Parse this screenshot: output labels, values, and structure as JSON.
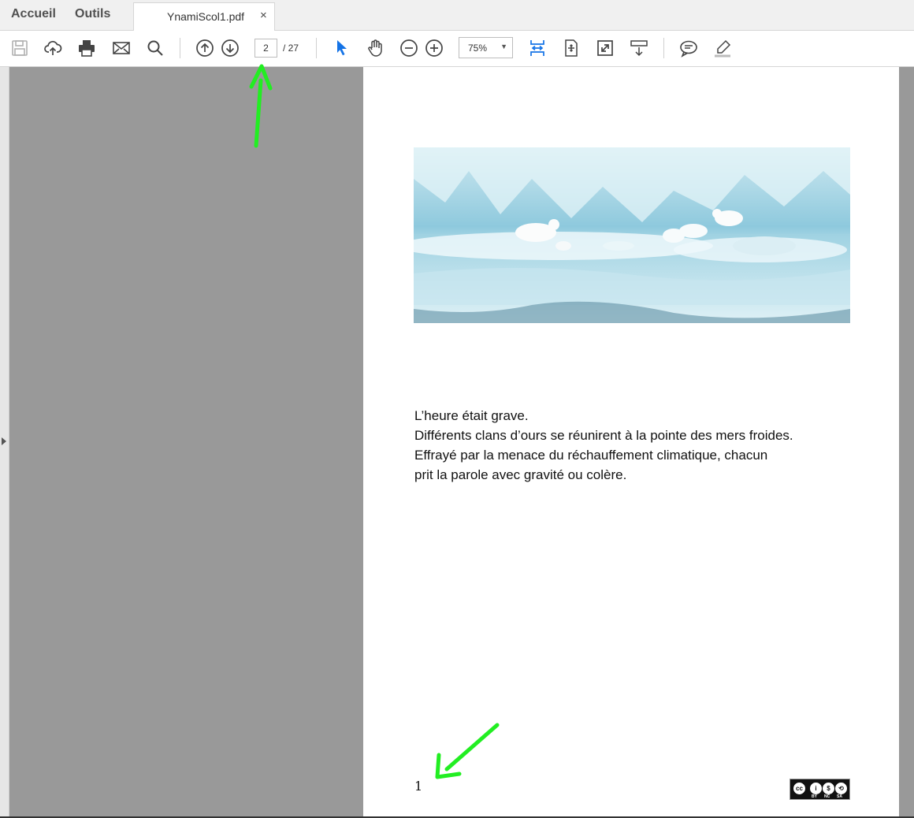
{
  "nav": {
    "home_label": "Accueil",
    "tools_label": "Outils"
  },
  "tab": {
    "filename": "YnamiScol1.pdf",
    "close_glyph": "×"
  },
  "toolbar": {
    "icons": [
      "save-icon",
      "upload-icon",
      "print-icon",
      "email-icon",
      "search-icon",
      "page-up-icon",
      "page-down-icon",
      "select-cursor-icon",
      "hand-icon",
      "zoom-out-icon",
      "zoom-in-icon",
      "fit-width-icon",
      "fit-page-icon",
      "fullscreen-icon",
      "scroll-mode-icon",
      "comment-icon",
      "highlight-icon"
    ],
    "current_page": "2",
    "page_total": "/ 27",
    "zoom": "75%",
    "accent_color": "#1473e6"
  },
  "document": {
    "lines": [
      "L’heure était grave.",
      "Différents clans d’ours se réunirent à la pointe des mers froides.",
      "Effrayé par la menace du réchauffement climatique,  chacun",
      "prit la parole avec gravité ou colère."
    ],
    "page_number": "1",
    "license": {
      "by": "BY",
      "nc": "NC",
      "sa": "SA"
    }
  },
  "annotations": {
    "arrow_color": "#22ee22"
  }
}
